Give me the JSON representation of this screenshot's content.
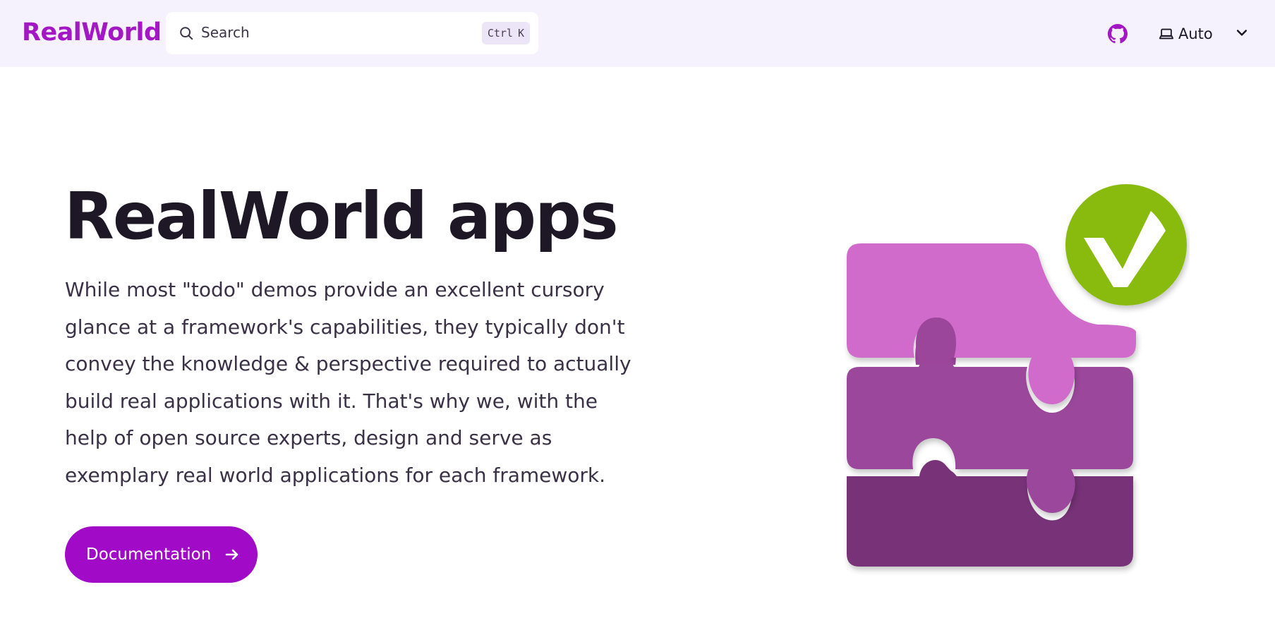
{
  "header": {
    "brand": "RealWorld",
    "search": {
      "placeholder": "Search",
      "shortcut_ctrl": "Ctrl",
      "shortcut_key": "K"
    },
    "github_icon": "github-icon",
    "theme": {
      "label": "Auto",
      "icon": "laptop-icon"
    }
  },
  "hero": {
    "title": "RealWorld apps",
    "description": "While most \"todo\" demos provide an excellent cursory glance at a framework's capabilities, they typically don't convey the knowledge & perspective required to actually build real applications with it. That's why we, with the help of open source experts, design and serve as exemplary real world applications for each framework.",
    "button_label": "Documentation",
    "button_icon": "arrow-right-icon"
  },
  "logo": {
    "icon": "puzzle-checkmark-logo"
  },
  "colors": {
    "brand": "#a317c4",
    "button": "#a10ac6",
    "nav_bg": "#f6f2fd",
    "puzzle_top": "#d06acb",
    "puzzle_mid": "#9b469b",
    "puzzle_bottom": "#773378",
    "check_green": "#88bb0c"
  }
}
